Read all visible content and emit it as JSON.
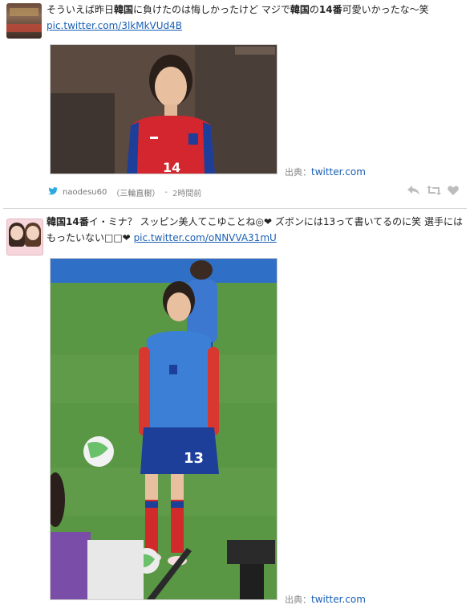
{
  "tweet1": {
    "text_parts": [
      "そういえば昨日",
      "韓国",
      "に負けたのは悔しかったけど マジで",
      "韓国",
      "の",
      "14番",
      "可愛いかったな～笑"
    ],
    "link": "pic.twitter.com/3lkMkVUd4B",
    "source_label": "出典：",
    "source_site": "twitter.com",
    "meta": {
      "username": "naodesu60",
      "display_name": "（三輪直樹）",
      "separator": "-",
      "time_ago": "2時間前"
    }
  },
  "tweet2": {
    "text_parts": [
      "韓国14番",
      "イ・ミナ？ スッピン美人てこゆことね◎❤ ズボンには13って書いてるのに笑 選手にはもったいない□□❤"
    ],
    "link": "pic.twitter.com/oNNVVA31mU",
    "source_label": "出典：",
    "source_site": "twitter.com"
  },
  "icons": {
    "bird": "twitter-bird-icon",
    "reply": "reply-icon",
    "retweet": "retweet-icon",
    "favorite": "heart-icon"
  },
  "colors": {
    "link": "#1a5fb4",
    "bird": "#2aa9e0"
  }
}
